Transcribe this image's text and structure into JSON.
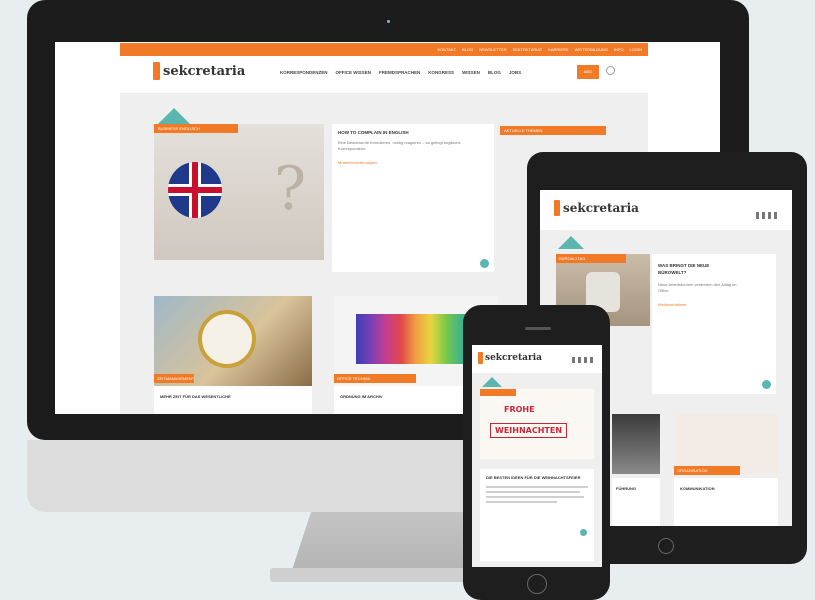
{
  "desktop": {
    "topbar_links": [
      "KONTAKT",
      "BLOG",
      "NEWSLETTER",
      "SEKTRETARIAT",
      "KARRIERE",
      "WEITERBILDUNG",
      "INFO",
      "LOGIN"
    ],
    "logo": "sekcretaria",
    "nav": [
      "KORRESPONDENZEN",
      "OFFICE WISSEN",
      "FREMDSPRACHEN",
      "KONGRESS",
      "WISSEN",
      "BLOG",
      "JOBS"
    ],
    "nav_button": "ABO",
    "feature": {
      "tag": "BUSINESS ENGLISCH",
      "title": "HOW TO COMPLAIN IN ENGLISH",
      "body": "Eine Beschwerde formulieren, richtig reagieren – so gelingt englische Korrespondenz.",
      "link": "Musterformulierungen"
    },
    "sidebar_tag": "AKTUELLE THEMEN",
    "card_tags": [
      "ZEITMANAGEMENT",
      "OFFICE TECHNIK"
    ],
    "card_titles": [
      "MEHR ZEIT FÜR DAS WESENTLICHE",
      "ORDNUNG IM ARCHIV"
    ]
  },
  "tablet": {
    "logo": "sekcretaria",
    "tag": "BÜROALLTAG",
    "title": "WAS BRINGT DIE NEUE BÜROWELT?",
    "body": "Neue Arbeitsformen verändern den Alltag im Office.",
    "link": "Weihnachtsfeier",
    "card_tag": "ORGANISATION",
    "card_titles": [
      "FÜHRUNG",
      "KOMMUNIKATION"
    ]
  },
  "phone": {
    "logo": "sekcretaria",
    "banner_line1": "FROHE",
    "banner_line2": "WEIHNACHTEN",
    "title": "DIE BESTEN IDEEN FÜR DIE WEIHNACHTSFEIER"
  },
  "colors": {
    "accent": "#f07a26",
    "teal": "#5bb6b0"
  }
}
